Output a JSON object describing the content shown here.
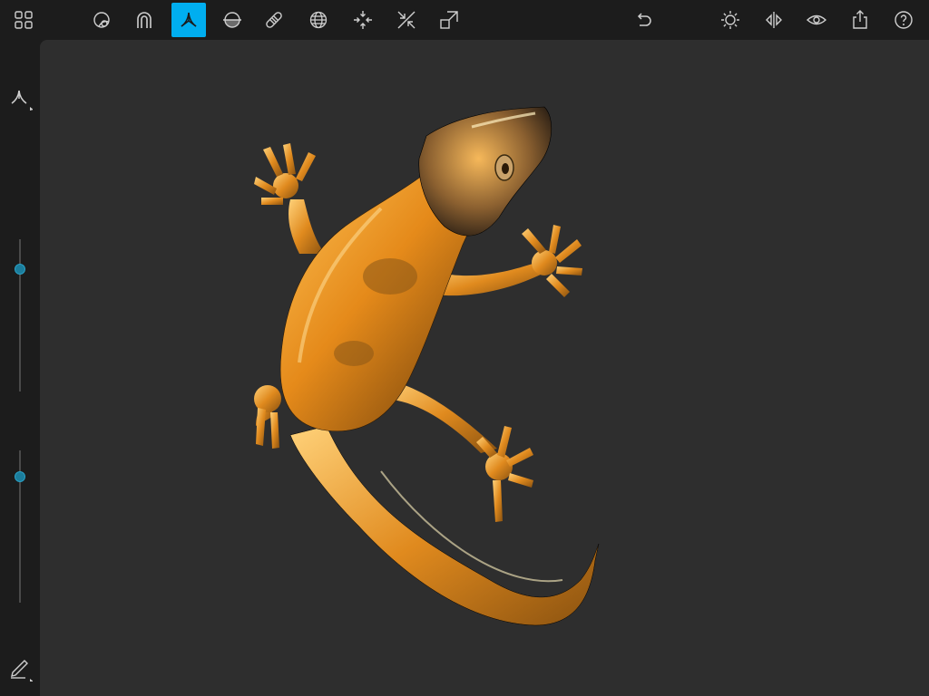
{
  "app": {
    "accent_color": "#00aef0",
    "model_color": "#e08a1e"
  },
  "toolbar": {
    "left": [
      {
        "name": "grid-menu-icon",
        "active": false
      },
      {
        "name": "clay-brush-icon",
        "active": false
      },
      {
        "name": "magnet-icon",
        "active": false
      },
      {
        "name": "pinch-tool-icon",
        "active": true
      },
      {
        "name": "flatten-icon",
        "active": false
      },
      {
        "name": "smooth-brush-icon",
        "active": false
      },
      {
        "name": "sphere-grid-icon",
        "active": false
      },
      {
        "name": "inflate-icon",
        "active": false
      },
      {
        "name": "deflate-icon",
        "active": false
      },
      {
        "name": "scale-move-icon",
        "active": false
      }
    ],
    "right": [
      {
        "name": "undo-icon"
      },
      {
        "name": "lighting-icon"
      },
      {
        "name": "symmetry-icon"
      },
      {
        "name": "view-eye-icon"
      },
      {
        "name": "share-icon"
      },
      {
        "name": "help-icon"
      }
    ]
  },
  "sidebar": {
    "tool_icon": "pinch-tool-icon",
    "bottom_icon": "pencil-icon",
    "sliders": [
      {
        "name": "brush-size-slider",
        "value": 0.2
      },
      {
        "name": "brush-strength-slider",
        "value": 0.2
      }
    ]
  }
}
